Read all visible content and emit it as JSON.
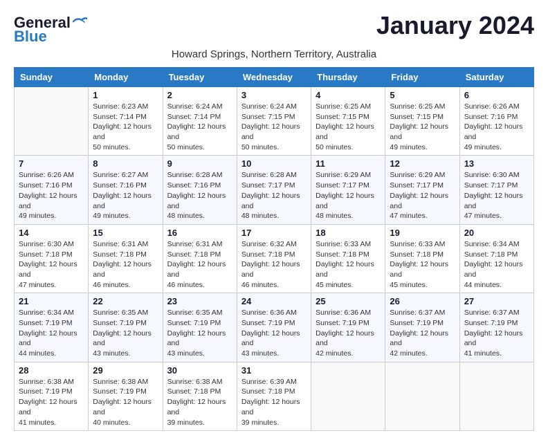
{
  "header": {
    "logo_line1": "General",
    "logo_line2": "Blue",
    "month_title": "January 2024",
    "subtitle": "Howard Springs, Northern Territory, Australia"
  },
  "weekdays": [
    "Sunday",
    "Monday",
    "Tuesday",
    "Wednesday",
    "Thursday",
    "Friday",
    "Saturday"
  ],
  "weeks": [
    [
      {
        "day": "",
        "sunrise": "",
        "sunset": "",
        "daylight": ""
      },
      {
        "day": "1",
        "sunrise": "Sunrise: 6:23 AM",
        "sunset": "Sunset: 7:14 PM",
        "daylight": "Daylight: 12 hours and 50 minutes."
      },
      {
        "day": "2",
        "sunrise": "Sunrise: 6:24 AM",
        "sunset": "Sunset: 7:14 PM",
        "daylight": "Daylight: 12 hours and 50 minutes."
      },
      {
        "day": "3",
        "sunrise": "Sunrise: 6:24 AM",
        "sunset": "Sunset: 7:15 PM",
        "daylight": "Daylight: 12 hours and 50 minutes."
      },
      {
        "day": "4",
        "sunrise": "Sunrise: 6:25 AM",
        "sunset": "Sunset: 7:15 PM",
        "daylight": "Daylight: 12 hours and 50 minutes."
      },
      {
        "day": "5",
        "sunrise": "Sunrise: 6:25 AM",
        "sunset": "Sunset: 7:15 PM",
        "daylight": "Daylight: 12 hours and 49 minutes."
      },
      {
        "day": "6",
        "sunrise": "Sunrise: 6:26 AM",
        "sunset": "Sunset: 7:16 PM",
        "daylight": "Daylight: 12 hours and 49 minutes."
      }
    ],
    [
      {
        "day": "7",
        "sunrise": "Sunrise: 6:26 AM",
        "sunset": "Sunset: 7:16 PM",
        "daylight": "Daylight: 12 hours and 49 minutes."
      },
      {
        "day": "8",
        "sunrise": "Sunrise: 6:27 AM",
        "sunset": "Sunset: 7:16 PM",
        "daylight": "Daylight: 12 hours and 49 minutes."
      },
      {
        "day": "9",
        "sunrise": "Sunrise: 6:28 AM",
        "sunset": "Sunset: 7:16 PM",
        "daylight": "Daylight: 12 hours and 48 minutes."
      },
      {
        "day": "10",
        "sunrise": "Sunrise: 6:28 AM",
        "sunset": "Sunset: 7:17 PM",
        "daylight": "Daylight: 12 hours and 48 minutes."
      },
      {
        "day": "11",
        "sunrise": "Sunrise: 6:29 AM",
        "sunset": "Sunset: 7:17 PM",
        "daylight": "Daylight: 12 hours and 48 minutes."
      },
      {
        "day": "12",
        "sunrise": "Sunrise: 6:29 AM",
        "sunset": "Sunset: 7:17 PM",
        "daylight": "Daylight: 12 hours and 47 minutes."
      },
      {
        "day": "13",
        "sunrise": "Sunrise: 6:30 AM",
        "sunset": "Sunset: 7:17 PM",
        "daylight": "Daylight: 12 hours and 47 minutes."
      }
    ],
    [
      {
        "day": "14",
        "sunrise": "Sunrise: 6:30 AM",
        "sunset": "Sunset: 7:18 PM",
        "daylight": "Daylight: 12 hours and 47 minutes."
      },
      {
        "day": "15",
        "sunrise": "Sunrise: 6:31 AM",
        "sunset": "Sunset: 7:18 PM",
        "daylight": "Daylight: 12 hours and 46 minutes."
      },
      {
        "day": "16",
        "sunrise": "Sunrise: 6:31 AM",
        "sunset": "Sunset: 7:18 PM",
        "daylight": "Daylight: 12 hours and 46 minutes."
      },
      {
        "day": "17",
        "sunrise": "Sunrise: 6:32 AM",
        "sunset": "Sunset: 7:18 PM",
        "daylight": "Daylight: 12 hours and 46 minutes."
      },
      {
        "day": "18",
        "sunrise": "Sunrise: 6:33 AM",
        "sunset": "Sunset: 7:18 PM",
        "daylight": "Daylight: 12 hours and 45 minutes."
      },
      {
        "day": "19",
        "sunrise": "Sunrise: 6:33 AM",
        "sunset": "Sunset: 7:18 PM",
        "daylight": "Daylight: 12 hours and 45 minutes."
      },
      {
        "day": "20",
        "sunrise": "Sunrise: 6:34 AM",
        "sunset": "Sunset: 7:18 PM",
        "daylight": "Daylight: 12 hours and 44 minutes."
      }
    ],
    [
      {
        "day": "21",
        "sunrise": "Sunrise: 6:34 AM",
        "sunset": "Sunset: 7:19 PM",
        "daylight": "Daylight: 12 hours and 44 minutes."
      },
      {
        "day": "22",
        "sunrise": "Sunrise: 6:35 AM",
        "sunset": "Sunset: 7:19 PM",
        "daylight": "Daylight: 12 hours and 43 minutes."
      },
      {
        "day": "23",
        "sunrise": "Sunrise: 6:35 AM",
        "sunset": "Sunset: 7:19 PM",
        "daylight": "Daylight: 12 hours and 43 minutes."
      },
      {
        "day": "24",
        "sunrise": "Sunrise: 6:36 AM",
        "sunset": "Sunset: 7:19 PM",
        "daylight": "Daylight: 12 hours and 43 minutes."
      },
      {
        "day": "25",
        "sunrise": "Sunrise: 6:36 AM",
        "sunset": "Sunset: 7:19 PM",
        "daylight": "Daylight: 12 hours and 42 minutes."
      },
      {
        "day": "26",
        "sunrise": "Sunrise: 6:37 AM",
        "sunset": "Sunset: 7:19 PM",
        "daylight": "Daylight: 12 hours and 42 minutes."
      },
      {
        "day": "27",
        "sunrise": "Sunrise: 6:37 AM",
        "sunset": "Sunset: 7:19 PM",
        "daylight": "Daylight: 12 hours and 41 minutes."
      }
    ],
    [
      {
        "day": "28",
        "sunrise": "Sunrise: 6:38 AM",
        "sunset": "Sunset: 7:19 PM",
        "daylight": "Daylight: 12 hours and 41 minutes."
      },
      {
        "day": "29",
        "sunrise": "Sunrise: 6:38 AM",
        "sunset": "Sunset: 7:19 PM",
        "daylight": "Daylight: 12 hours and 40 minutes."
      },
      {
        "day": "30",
        "sunrise": "Sunrise: 6:38 AM",
        "sunset": "Sunset: 7:18 PM",
        "daylight": "Daylight: 12 hours and 39 minutes."
      },
      {
        "day": "31",
        "sunrise": "Sunrise: 6:39 AM",
        "sunset": "Sunset: 7:18 PM",
        "daylight": "Daylight: 12 hours and 39 minutes."
      },
      {
        "day": "",
        "sunrise": "",
        "sunset": "",
        "daylight": ""
      },
      {
        "day": "",
        "sunrise": "",
        "sunset": "",
        "daylight": ""
      },
      {
        "day": "",
        "sunrise": "",
        "sunset": "",
        "daylight": ""
      }
    ]
  ]
}
